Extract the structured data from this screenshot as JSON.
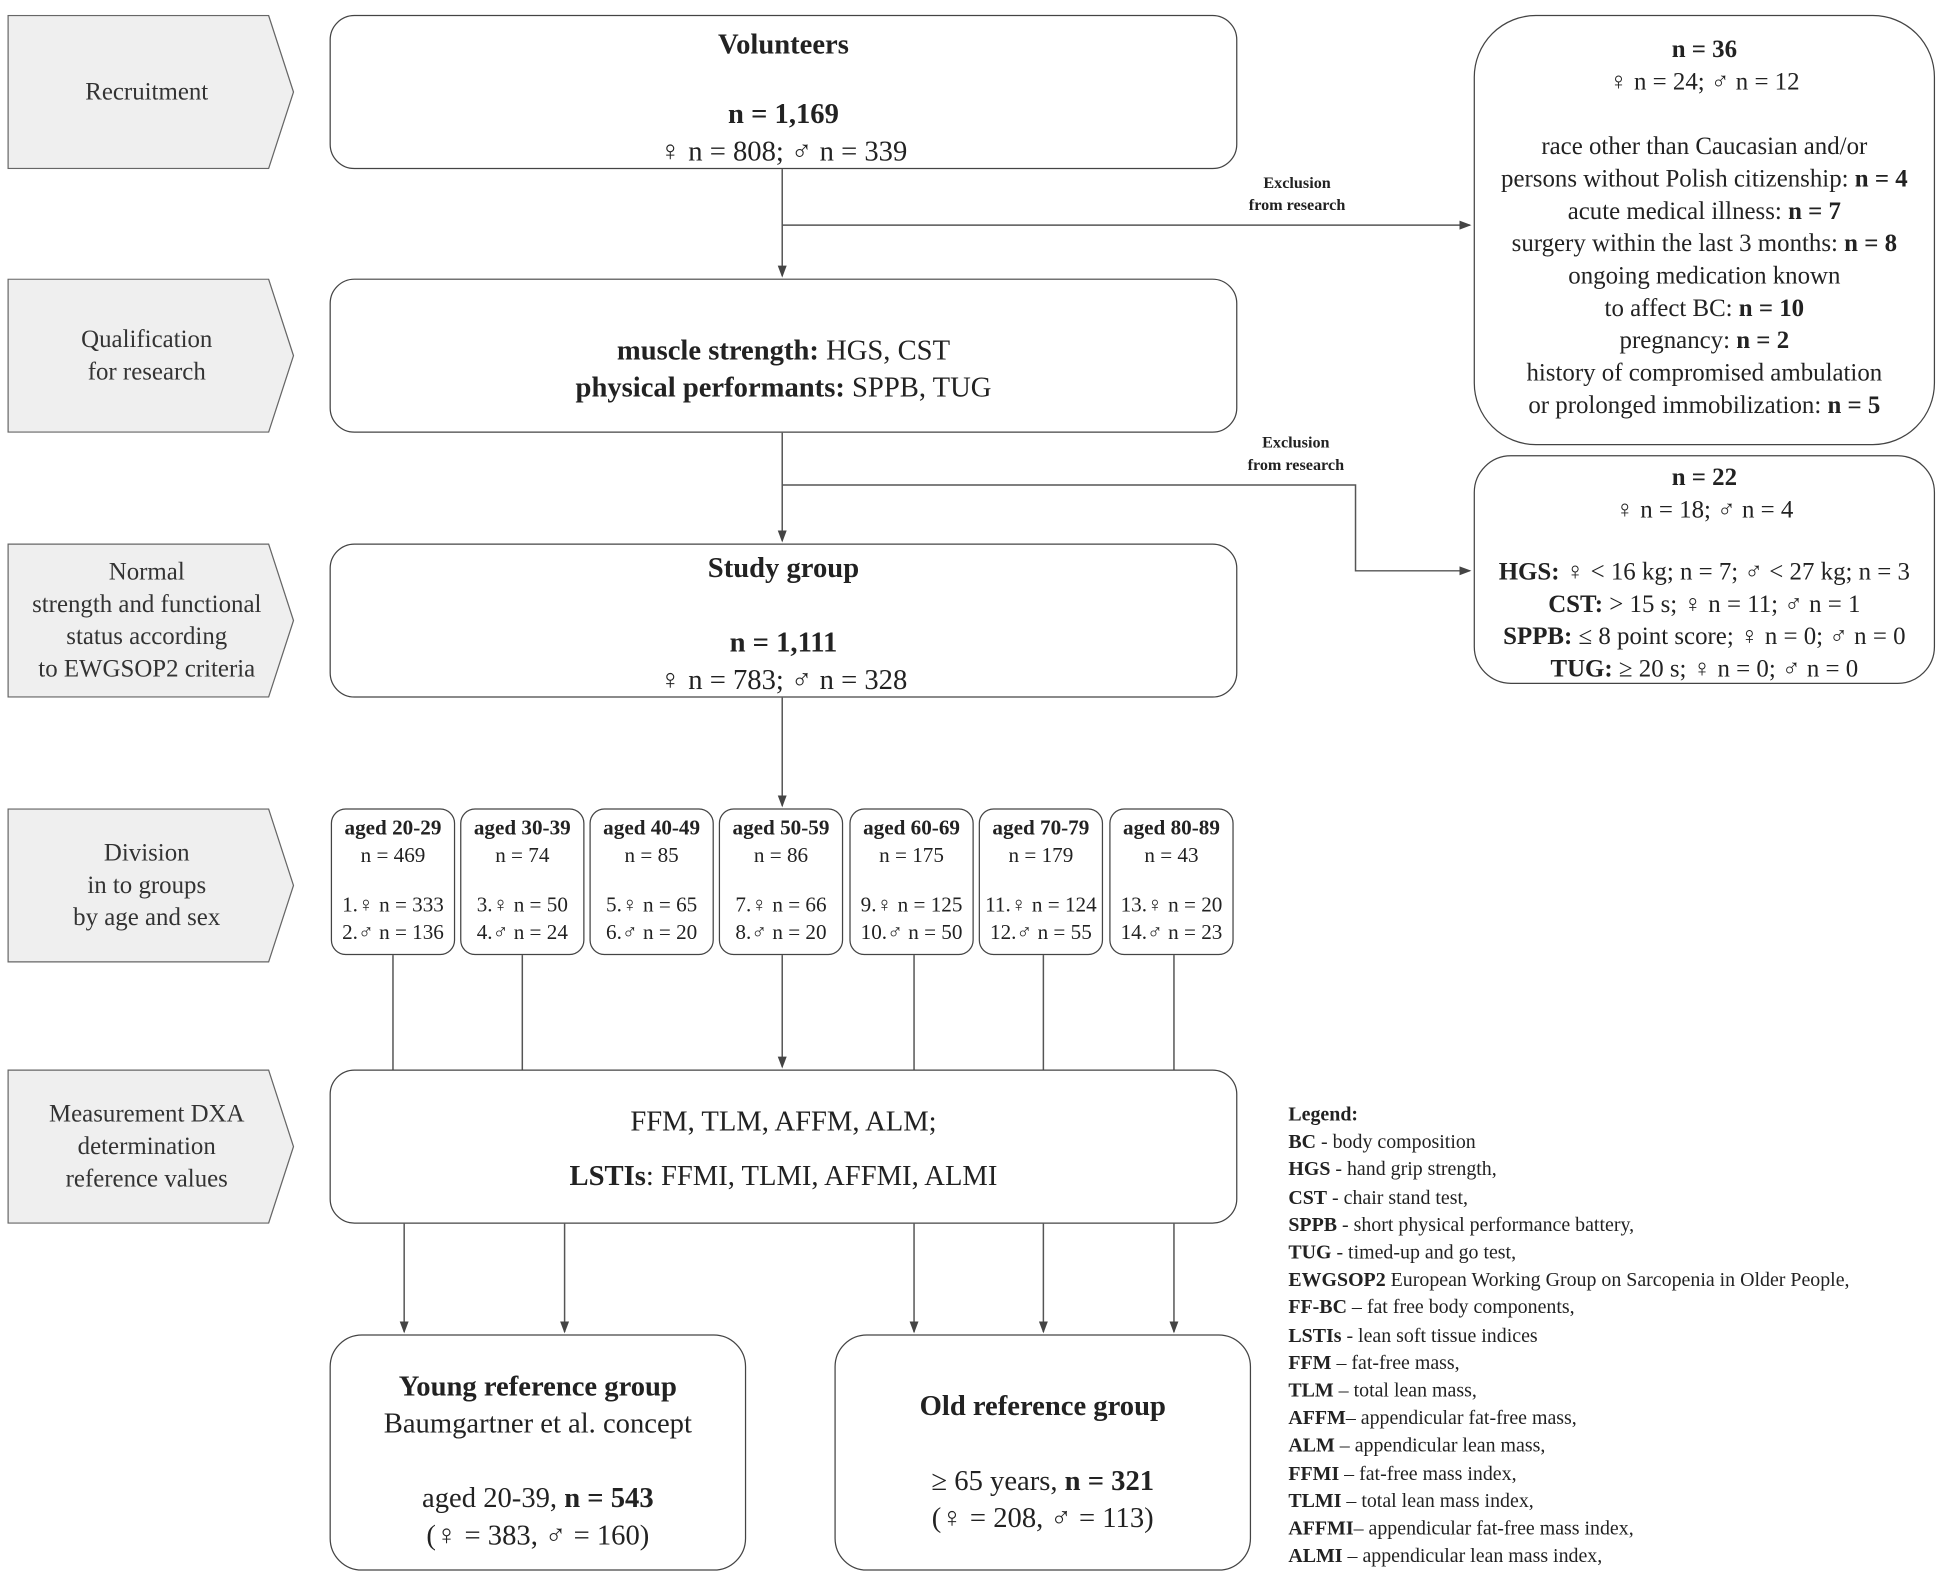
{
  "stages": [
    "Recruitment",
    "Qualification for research",
    "Normal strength and functional status according to EWGSOP2 criteria",
    "Division in to groups by age and sex",
    "Measurement DXA determination reference values"
  ],
  "stage_lines": [
    [
      "Recruitment"
    ],
    [
      "Qualification",
      "for research"
    ],
    [
      "Normal",
      "strength and functional",
      "status according",
      "to EWGSOP2 criteria"
    ],
    [
      "Division",
      "in to groups",
      "by age and sex"
    ],
    [
      "Measurement DXA",
      "determination",
      "reference values"
    ]
  ],
  "volunteers": {
    "title": "Volunteers",
    "n": "n = 1,169",
    "sex": "♀ n = 808; ♂ n = 339"
  },
  "qualification": {
    "l1_bold": "muscle strength:",
    "l1": " HGS, CST",
    "l2_bold": "physical performants:",
    "l2": " SPPB, TUG"
  },
  "study_group": {
    "title": "Study group",
    "n": "n = 1,111",
    "sex": "♀ n = 783; ♂ n = 328"
  },
  "exclusion_label": [
    "Exclusion",
    "from research"
  ],
  "exclusion1": {
    "n": "n = 36",
    "sex": "♀ n = 24; ♂ n = 12",
    "items": [
      {
        "text": "race other than Caucasian and/or",
        "n": ""
      },
      {
        "text": "persons without Polish citizenship: ",
        "n": "n = 4"
      },
      {
        "text": "acute medical illness: ",
        "n": "n = 7"
      },
      {
        "text": "surgery within the last 3 months: ",
        "n": "n = 8"
      },
      {
        "text": "ongoing medication known",
        "n": ""
      },
      {
        "text": "to affect BC: ",
        "n": "n = 10"
      },
      {
        "text": "pregnancy: ",
        "n": "n = 2"
      },
      {
        "text": "history of compromised ambulation",
        "n": ""
      },
      {
        "text": "or prolonged immobilization: ",
        "n": "n =  5"
      }
    ]
  },
  "exclusion2": {
    "n": "n = 22",
    "sex": "♀ n = 18; ♂ n = 4",
    "items": [
      {
        "label": "HGS:",
        "text": " ♀ < 16 kg; n = 7; ♂ < 27 kg; n = 3"
      },
      {
        "label": "CST:",
        "text": " > 15 s; ♀ n = 11; ♂ n = 1"
      },
      {
        "label": "SPPB:",
        "text": " ≤ 8 point score; ♀ n = 0; ♂ n = 0"
      },
      {
        "label": "TUG:",
        "text": " ≥ 20 s; ♀ n = 0; ♂ n = 0"
      }
    ]
  },
  "age_groups": [
    {
      "title": "aged 20-29",
      "n": "n = 469",
      "f": "1.♀ n = 333",
      "m": "2.♂ n = 136"
    },
    {
      "title": "aged 30-39",
      "n": "n = 74",
      "f": "3.♀ n = 50",
      "m": "4.♂ n = 24"
    },
    {
      "title": "aged 40-49",
      "n": "n = 85",
      "f": "5.♀ n = 65",
      "m": "6.♂ n = 20"
    },
    {
      "title": "aged 50-59",
      "n": "n = 86",
      "f": "7.♀ n = 66",
      "m": "8.♂ n = 20"
    },
    {
      "title": "aged 60-69",
      "n": "n = 175",
      "f": "9.♀ n = 125",
      "m": "10.♂ n = 50"
    },
    {
      "title": "aged 70-79",
      "n": "n = 179",
      "f": "11.♀ n = 124",
      "m": "12.♂ n = 55"
    },
    {
      "title": "aged 80-89",
      "n": "n = 43",
      "f": "13.♀ n = 20",
      "m": "14.♂ n = 23"
    }
  ],
  "dxa": {
    "l1": "FFM, TLM, AFFM, ALM;",
    "l2_bold": "LSTIs",
    "l2": ": FFMI, TLMI, AFFMI, ALMI"
  },
  "young": {
    "title": "Young reference group",
    "subtitle": "Baumgartner et al. concept",
    "age": "aged 20-39, ",
    "n": "n = 543",
    "sex": "(♀ = 383, ♂ = 160)"
  },
  "old": {
    "title": "Old reference group",
    "age": "≥ 65 years, ",
    "n": "n = 321",
    "sex": "(♀ = 208, ♂ = 113)"
  },
  "legend": {
    "title": "Legend:",
    "items": [
      {
        "abbr": "BC",
        "def": " - body composition"
      },
      {
        "abbr": "HGS",
        "def": " - hand grip strength,"
      },
      {
        "abbr": "CST",
        "def": " - chair stand test,"
      },
      {
        "abbr": "SPPB",
        "def": " - short physical performance battery,"
      },
      {
        "abbr": "TUG",
        "def": " - timed-up and go test,"
      },
      {
        "abbr": "EWGSOP2",
        "def": " European Working Group on Sarcopenia in Older People,"
      },
      {
        "abbr": "FF-BC",
        "def": " – fat free body components,"
      },
      {
        "abbr": "LSTIs",
        "def": " - lean soft tissue indices"
      },
      {
        "abbr": "FFM",
        "def": " – fat-free mass,"
      },
      {
        "abbr": "TLM",
        "def": " – total lean mass,"
      },
      {
        "abbr": "AFFM",
        "def": "– appendicular fat-free mass,"
      },
      {
        "abbr": "ALM",
        "def": " – appendicular lean mass,"
      },
      {
        "abbr": "FFMI",
        "def": " – fat-free mass index,"
      },
      {
        "abbr": "TLMI",
        "def": " – total lean mass index,"
      },
      {
        "abbr": "AFFMI",
        "def": "– appendicular fat-free mass index,"
      },
      {
        "abbr": "ALMI",
        "def": " – appendicular lean mass index,"
      }
    ]
  },
  "colors": {
    "stage_fill": "#efefef",
    "border": "#444444",
    "text": "#222222"
  }
}
